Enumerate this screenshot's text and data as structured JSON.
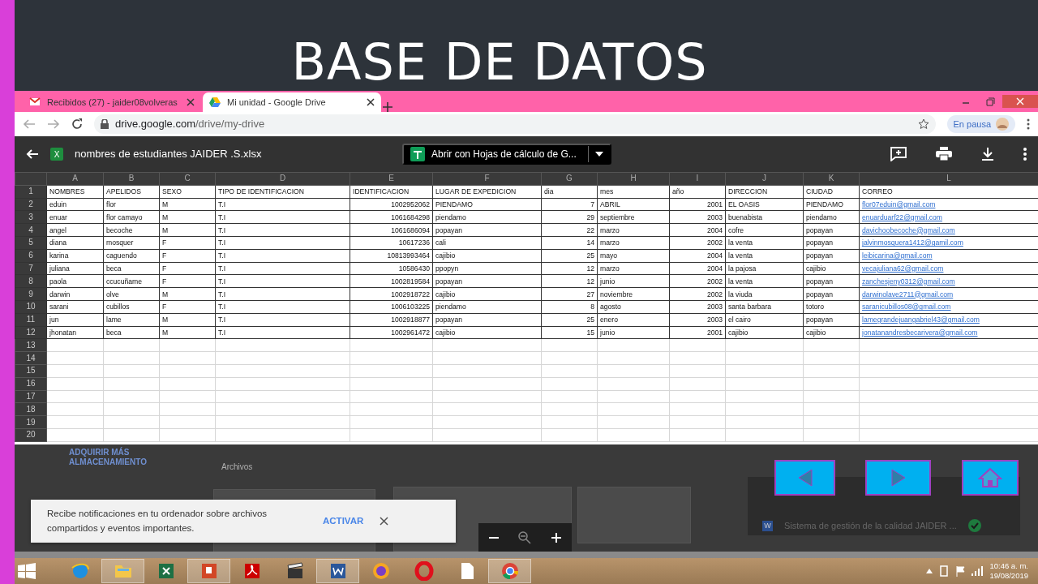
{
  "slide": {
    "title": "BASE DE DATOS"
  },
  "browser": {
    "tabs": [
      {
        "label": "Recibidos (27) - jaider08volveras",
        "selected": false,
        "kind": "mail"
      },
      {
        "label": "Mi unidad - Google Drive",
        "selected": true,
        "kind": "drive"
      }
    ],
    "address_host": "drive.google.com",
    "address_path": "/drive/my-drive",
    "profile_label": "En pausa"
  },
  "viewer": {
    "file_badge": "X",
    "file_name": "nombres de estudiantes JAIDER .S.xlsx",
    "open_with": "Abrir con Hojas de cálculo de G..."
  },
  "sheet": {
    "columns": [
      {
        "letter": "A",
        "kind": "text"
      },
      {
        "letter": "B",
        "kind": "text"
      },
      {
        "letter": "C",
        "kind": "text"
      },
      {
        "letter": "D",
        "kind": "text"
      },
      {
        "letter": "E",
        "kind": "number"
      },
      {
        "letter": "F",
        "kind": "text"
      },
      {
        "letter": "G",
        "kind": "number"
      },
      {
        "letter": "H",
        "kind": "text"
      },
      {
        "letter": "I",
        "kind": "number"
      },
      {
        "letter": "J",
        "kind": "text"
      },
      {
        "letter": "K",
        "kind": "text"
      },
      {
        "letter": "L",
        "kind": "link"
      }
    ],
    "row_numbers": [
      "1",
      "2",
      "3",
      "4",
      "5",
      "6",
      "7",
      "8",
      "9",
      "10",
      "11",
      "12",
      "13",
      "14",
      "15",
      "16",
      "17",
      "18",
      "19",
      "20"
    ],
    "rows": [
      [
        "NOMBRES",
        "APELIDOS",
        "SEXO",
        "TIPO DE IDENTIFICACION",
        "IDENTIFICACION",
        "LUGAR DE EXPEDICION",
        "dia",
        "mes",
        "año",
        "DIRECCION",
        "CIUDAD",
        "CORREO"
      ],
      [
        "eduin",
        "flor",
        "M",
        "T.I",
        "1002952062",
        "PIENDAMO",
        "7",
        "ABRIL",
        "2001",
        "EL OASIS",
        "PIENDAMO",
        "flor07eduin@gmail.com"
      ],
      [
        "enuar",
        "flor camayo",
        "M",
        "T.I",
        "1061684298",
        "piendamo",
        "29",
        "septiembre",
        "2003",
        "buenabista",
        "piendamo",
        "enuarduarf22@gmail.com"
      ],
      [
        "angel",
        "becoche",
        "M",
        "T.I",
        "1061686094",
        "popayan",
        "22",
        "marzo",
        "2004",
        "cofre",
        "popayan",
        "davichoobecoche@gmail.com"
      ],
      [
        "diana",
        "mosquer",
        "F",
        "T.I",
        "10617236",
        "cali",
        "14",
        "marzo",
        "2002",
        "la venta",
        "popayan",
        "jalvinmosquera1412@gamil.com"
      ],
      [
        "karina",
        "caguendo",
        "F",
        "T.I",
        "10813993464",
        "cajibio",
        "25",
        "mayo",
        "2004",
        "la venta",
        "popayan",
        "leibicarina@gmail.com"
      ],
      [
        "juliana",
        "beca",
        "F",
        "T.I",
        "10586430",
        "ppopyn",
        "12",
        "marzo",
        "2004",
        "la pajosa",
        "cajibio",
        "vecajuliana62@gmail.com"
      ],
      [
        "paola",
        "ccucuñame",
        "F",
        "T.I",
        "1002819584",
        "popayan",
        "12",
        "junio",
        "2002",
        "la venta",
        "popayan",
        "zanchesjeny0312@gmail.com"
      ],
      [
        "darwin",
        "olve",
        "M",
        "T.I",
        "1002918722",
        "cajibio",
        "27",
        "noviembre",
        "2002",
        "la viuda",
        "popayan",
        "darwinolave2711@gmail.com"
      ],
      [
        "sarani",
        "cubillos",
        "F",
        "T.I",
        "1006103225",
        "piendamo",
        "8",
        "agosto",
        "2003",
        "santa barbara",
        "totoro",
        "saranicubillos08@gmail.com"
      ],
      [
        "jun",
        "lame",
        "M",
        "T.I",
        "1002918877",
        "popayan",
        "25",
        "enero",
        "2003",
        "el cairo",
        "popayan",
        "lamegrandejuangabriel43@gmail.com"
      ],
      [
        "jhonatan",
        "beca",
        "M",
        "T.I",
        "1002961472",
        "cajibio",
        "15",
        "junio",
        "2001",
        "cajibio",
        "cajibio",
        "jonatanandresbecarivera@gmail.com"
      ]
    ]
  },
  "background": {
    "storage_link": "ADQUIRIR MÁS ALMACENAMIENTO",
    "section": "Archivos",
    "side_item_badge": "W",
    "side_item": "Sistema de gestión de la calidad JAIDER ..."
  },
  "notice": {
    "text": "Recibe notificaciones en tu ordenador sobre archivos compartidos y eventos importantes.",
    "action": "ACTIVAR"
  },
  "taskbar": {
    "apps": [
      {
        "kind": "ie",
        "open": false
      },
      {
        "kind": "folder",
        "open": true
      },
      {
        "kind": "sheet",
        "open": false
      },
      {
        "kind": "slides",
        "open": true
      },
      {
        "kind": "pdf",
        "open": false
      },
      {
        "kind": "media",
        "open": false
      },
      {
        "kind": "doc",
        "open": true
      },
      {
        "kind": "shield",
        "open": false
      },
      {
        "kind": "ring",
        "open": false
      },
      {
        "kind": "file",
        "open": false
      },
      {
        "kind": "chrome",
        "open": true
      }
    ],
    "time": "10:46 a. m.",
    "date": "19/08/2019"
  }
}
